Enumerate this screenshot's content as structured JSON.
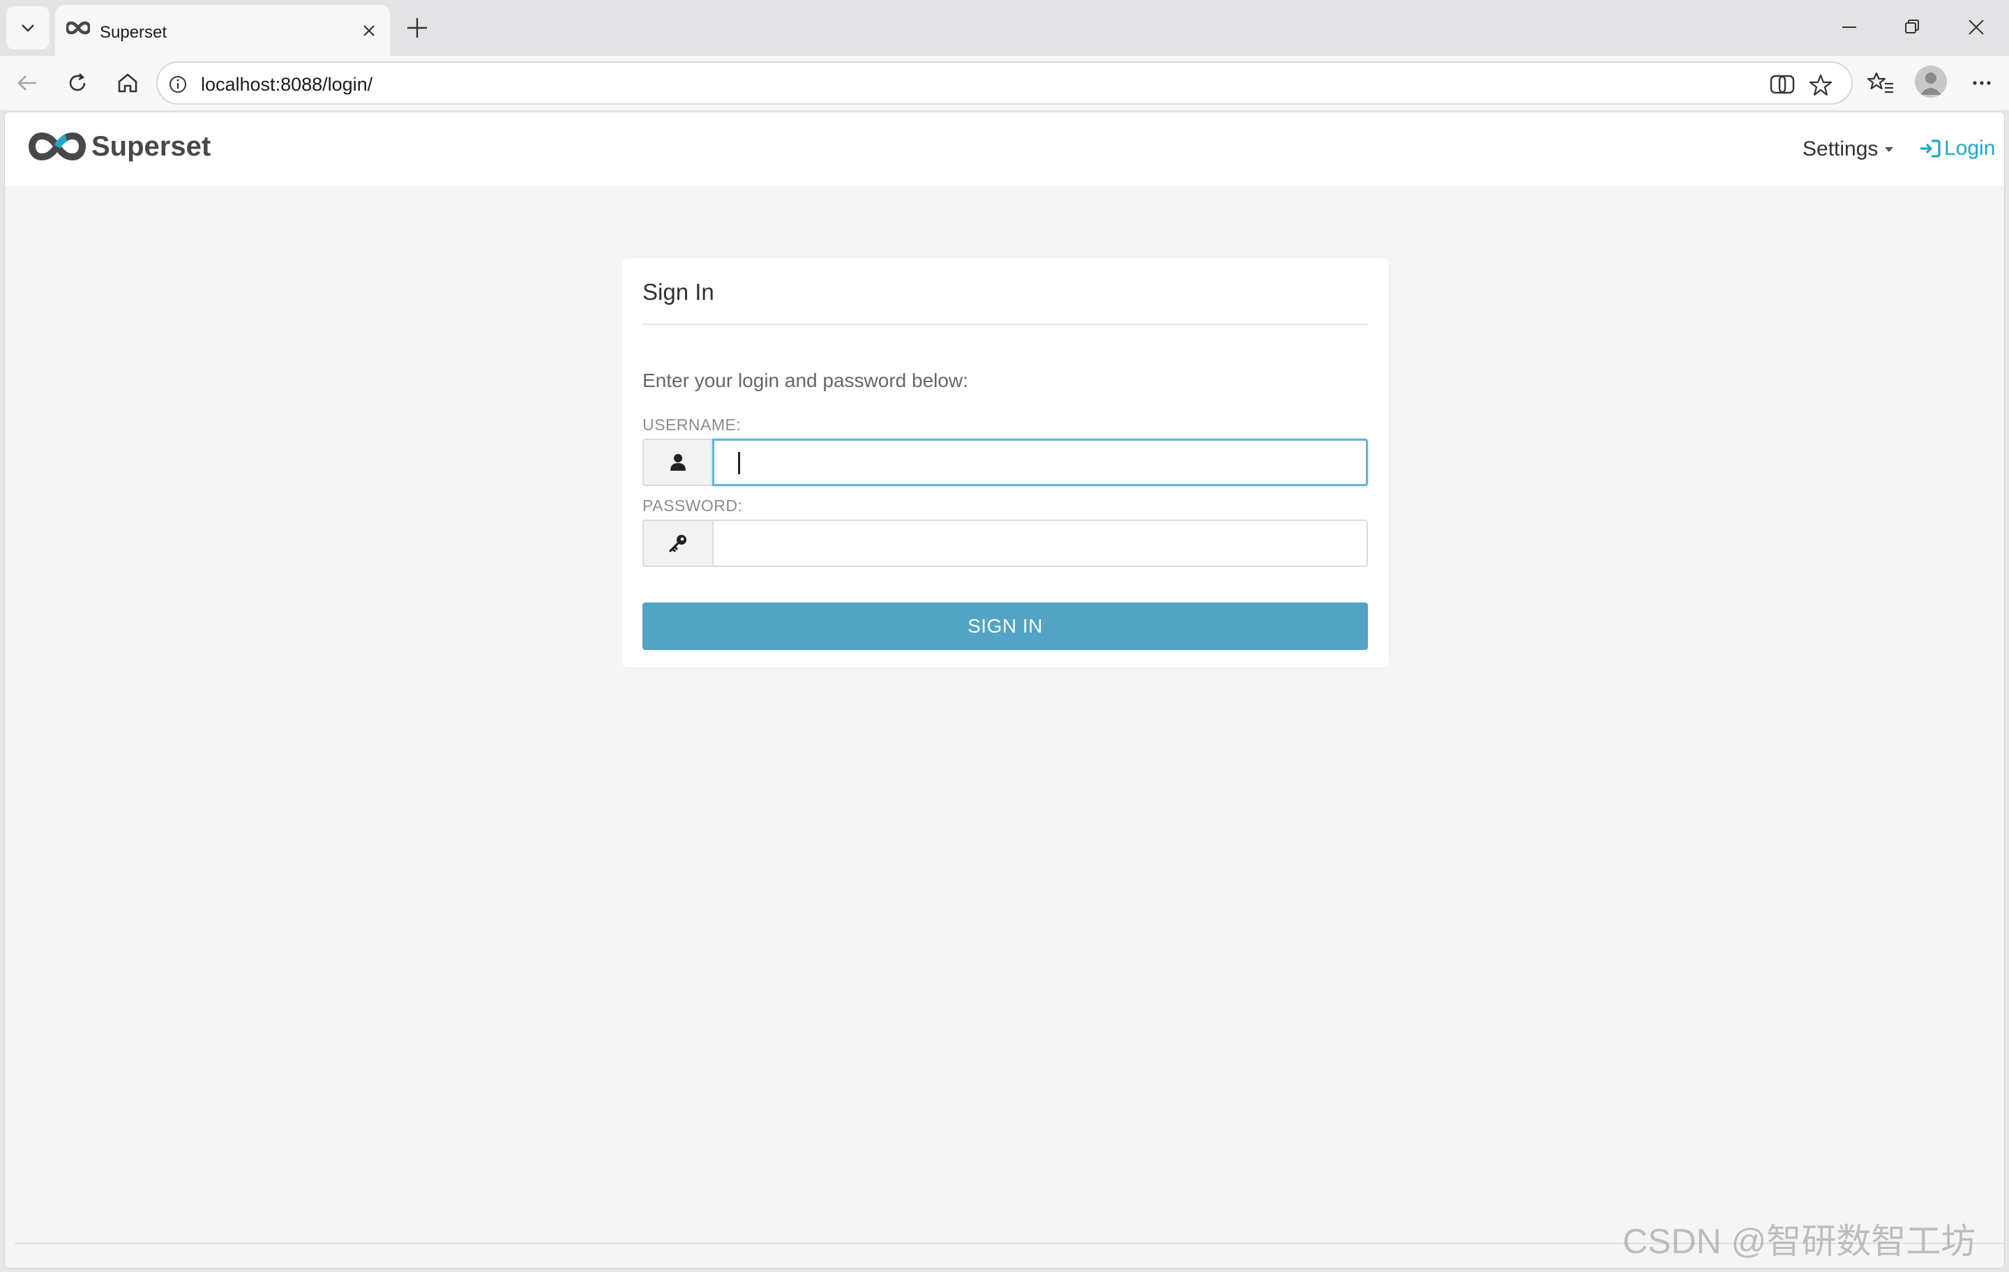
{
  "browser": {
    "tab_title": "Superset",
    "url": "localhost:8088/login/"
  },
  "navbar": {
    "brand": "Superset",
    "settings_label": "Settings",
    "login_label": "Login"
  },
  "login_form": {
    "title": "Sign In",
    "intro": "Enter your login and password below:",
    "username_label": "USERNAME:",
    "username_value": "",
    "password_label": "PASSWORD:",
    "password_value": "",
    "submit_label": "SIGN IN"
  },
  "watermark": "CSDN @智研数智工坊",
  "icons": {
    "tab_menu": "chevron-down-icon",
    "favicon": "superset-logo-icon",
    "tab_close": "close-icon",
    "new_tab": "plus-icon",
    "minimize": "minimize-icon",
    "restore": "restore-icon",
    "window_close": "close-icon",
    "back": "back-arrow-icon",
    "reload": "reload-icon",
    "home": "home-icon",
    "site_info": "info-icon",
    "copilot": "copilot-icon",
    "favorite": "star-icon",
    "favorites": "favorites-list-icon",
    "profile": "profile-avatar-icon",
    "more": "more-icon",
    "username_addon": "user-icon",
    "password_addon": "key-icon",
    "login_link": "sign-in-icon"
  },
  "colors": {
    "accent": "#20a7c9",
    "button": "#52a3c4",
    "focus_border": "#66b5d3",
    "page_background": "#f5f5f5"
  }
}
